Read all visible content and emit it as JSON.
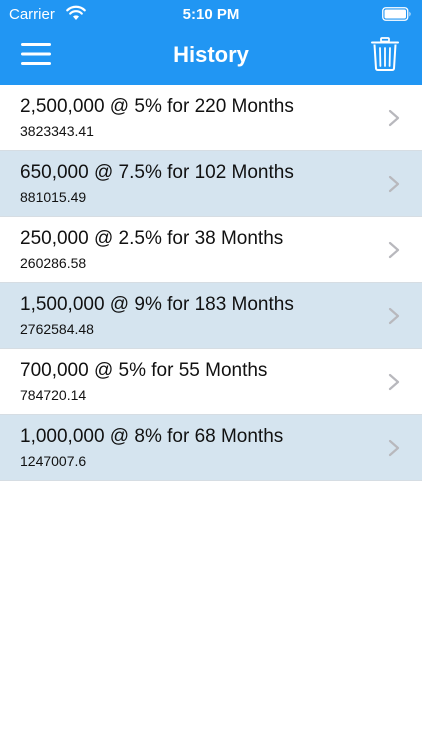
{
  "status_bar": {
    "carrier": "Carrier",
    "time": "5:10 PM"
  },
  "header": {
    "title": "History",
    "background": "#2196f3",
    "menu_icon": "hamburger-menu-icon",
    "trash_icon": "trash-icon"
  },
  "history": {
    "items": [
      {
        "title": "2,500,000 @ 5% for 220 Months",
        "result": "3823343.41"
      },
      {
        "title": "650,000 @ 7.5% for 102 Months",
        "result": "881015.49"
      },
      {
        "title": "250,000 @ 2.5% for 38 Months",
        "result": "260286.58"
      },
      {
        "title": "1,500,000 @ 9% for 183 Months",
        "result": "2762584.48"
      },
      {
        "title": "700,000 @ 5% for 55 Months",
        "result": "784720.14"
      },
      {
        "title": "1,000,000 @ 8% for 68 Months",
        "result": "1247007.6"
      }
    ],
    "alt_row_color": "#d5e4ef"
  }
}
